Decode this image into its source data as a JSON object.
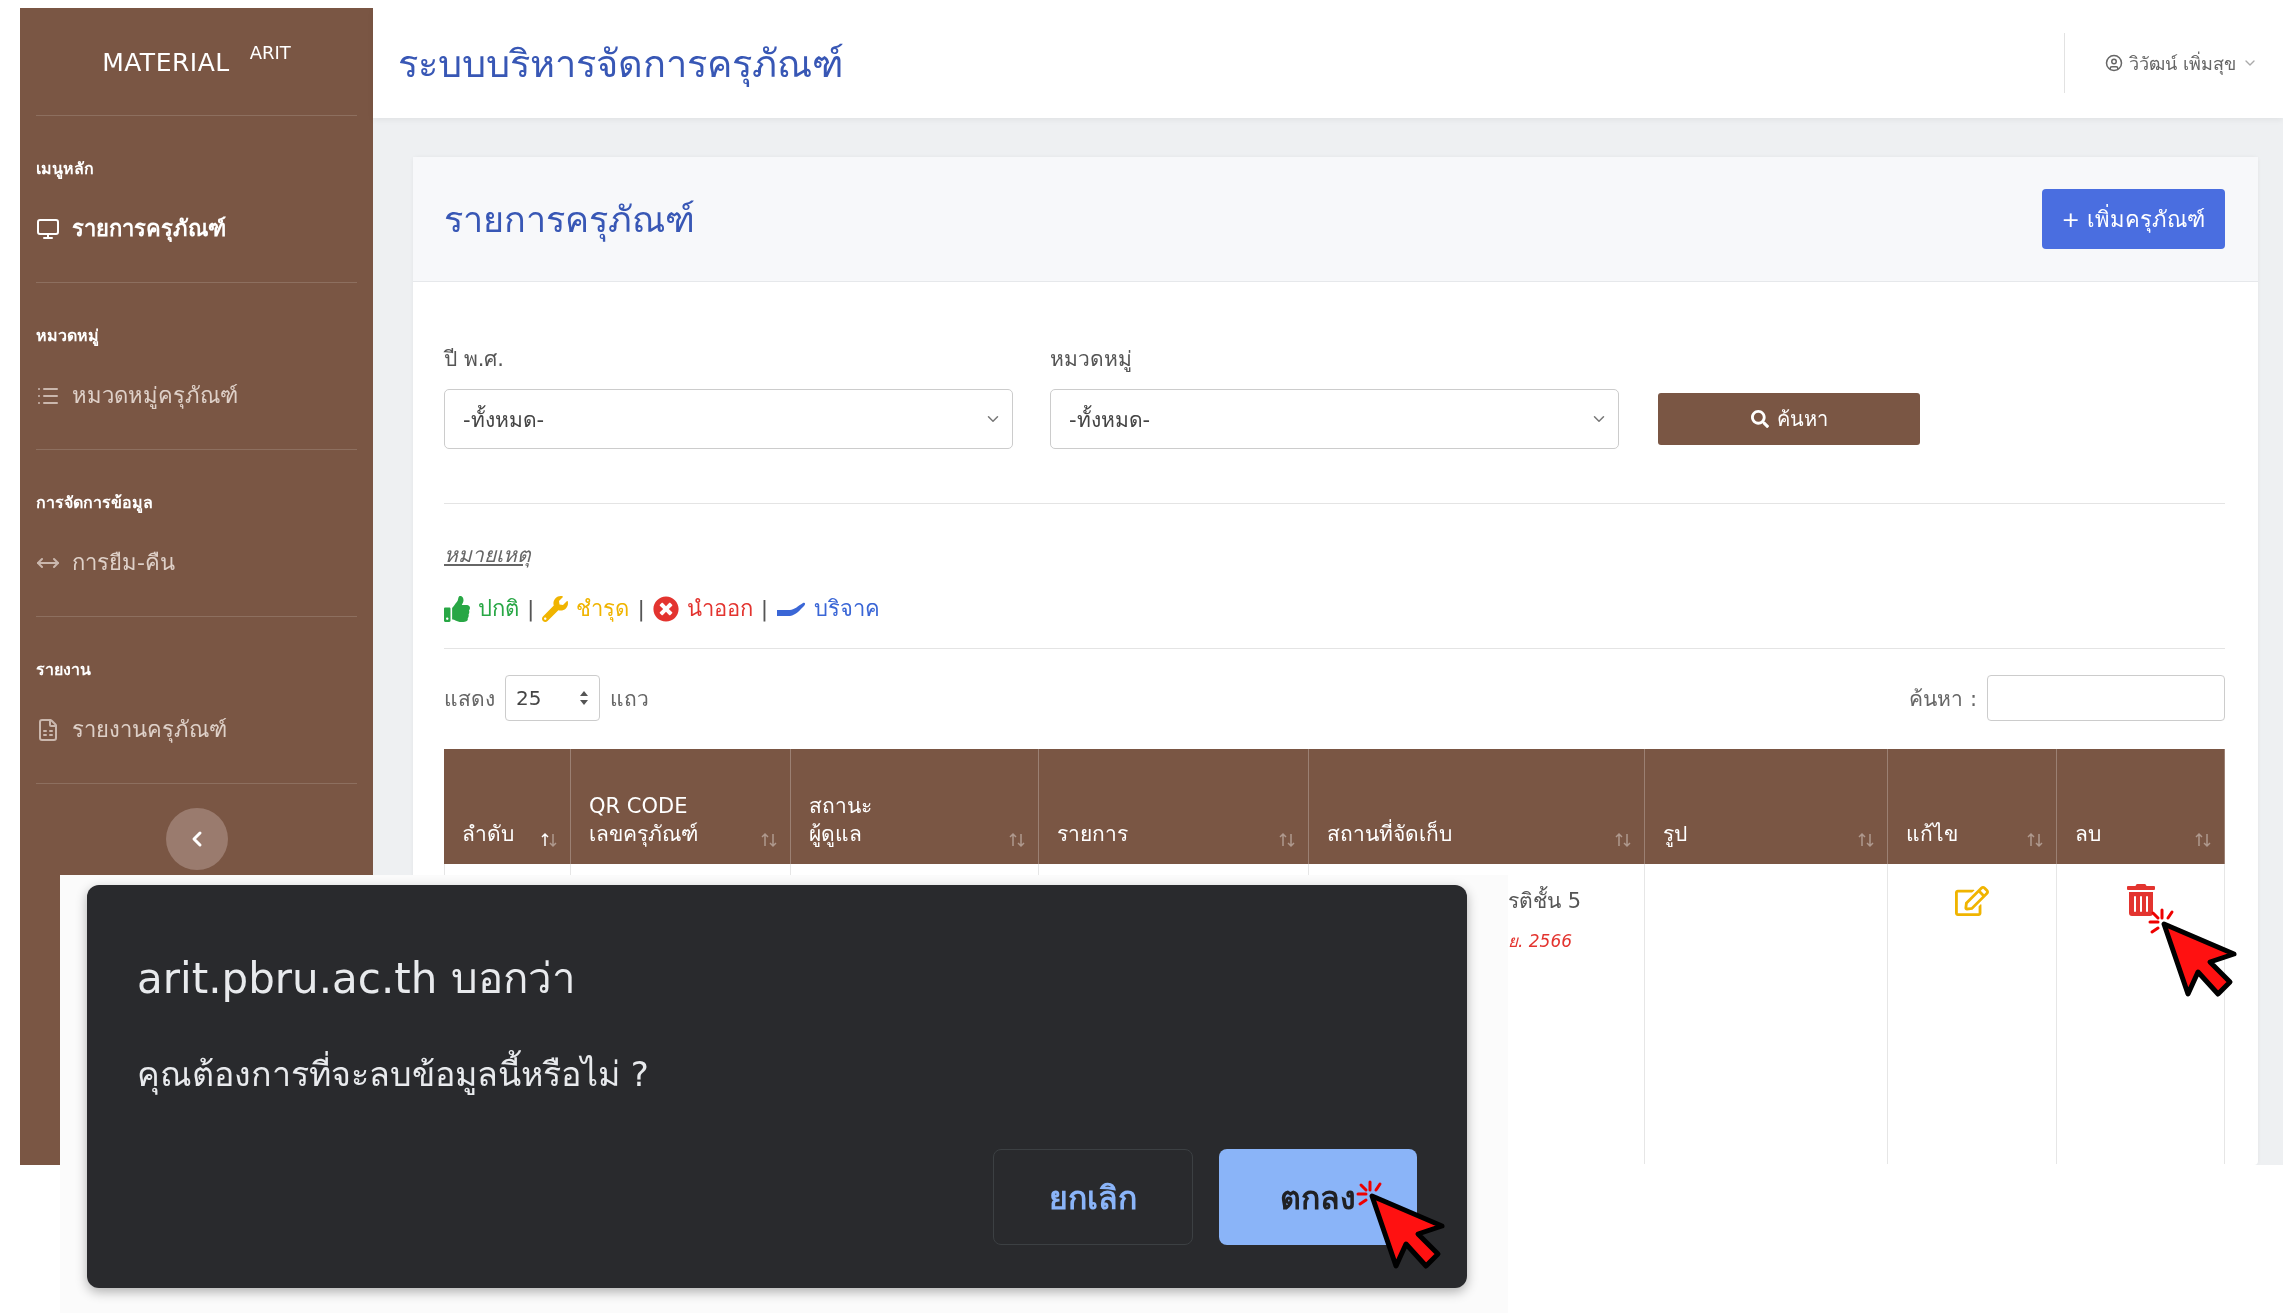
{
  "sidebar": {
    "brand": "MATERIAL",
    "brand_sup": "ARIT",
    "sections": [
      {
        "heading": "เมนูหลัก",
        "item": {
          "label": "รายการครุภัณฑ์",
          "kind": "monitor",
          "selected": true
        }
      },
      {
        "heading": "หมวดหมู่",
        "item": {
          "label": "หมวดหมู่ครุภัณฑ์",
          "kind": "list",
          "selected": false
        }
      },
      {
        "heading": "การจัดการข้อมูล",
        "item": {
          "label": "การยืม-คืน",
          "kind": "arrows",
          "selected": false
        }
      },
      {
        "heading": "รายงาน",
        "item": {
          "label": "รายงานครุภัณฑ์",
          "kind": "file",
          "selected": false
        }
      }
    ]
  },
  "header": {
    "title": "ระบบบริหารจัดการครุภัณฑ์",
    "user": "วิวัฒน์ เพิ่มสุข"
  },
  "card": {
    "title": "รายการครุภัณฑ์",
    "add_button": "+ เพิ่มครุภัณฑ์"
  },
  "filters": [
    {
      "label": "ปี พ.ศ.",
      "value": "-ทั้งหมด-"
    },
    {
      "label": "หมวดหมู่",
      "value": "-ทั้งหมด-"
    }
  ],
  "search_button": "ค้นหา",
  "legend": {
    "title": "หมายเหตุ",
    "separator": "|",
    "items": [
      {
        "label": "ปกติ",
        "kind": "thumbs",
        "color": "#28a745"
      },
      {
        "label": "ชำรุด",
        "kind": "wrench",
        "color": "#f0b400"
      },
      {
        "label": "นำออก",
        "kind": "cross",
        "color": "#e3342f"
      },
      {
        "label": "บริจาค",
        "kind": "hand",
        "color": "#3a66d6"
      }
    ]
  },
  "table_controls": {
    "show_label": "แสดง",
    "page_size": "25",
    "rows_label": "แถว",
    "search_label": "ค้นหา :"
  },
  "table": {
    "columns": [
      {
        "lines": [
          "ลำดับ"
        ],
        "sorted": true
      },
      {
        "lines": [
          "QR CODE",
          "เลขครุภัณฑ์"
        ],
        "sorted": false
      },
      {
        "lines": [
          "สถานะ",
          "ผู้ดูแล"
        ],
        "sorted": false
      },
      {
        "lines": [
          "รายการ"
        ],
        "sorted": false
      },
      {
        "lines": [
          "สถานที่จัดเก็บ"
        ],
        "sorted": false
      },
      {
        "lines": [
          "รูป"
        ],
        "sorted": false
      },
      {
        "lines": [
          "แก้ไข"
        ],
        "sorted": false
      },
      {
        "lines": [
          "ลบ"
        ],
        "sorted": false
      }
    ],
    "rows": [
      {
        "location": "รติชั้น 5",
        "location_note": "ย. 2566"
      }
    ]
  },
  "dialog": {
    "origin": "arit.pbru.ac.th บอกว่า",
    "message": "คุณต้องการที่จะลบข้อมูลนี้หรือไม่ ?",
    "buttons": [
      {
        "label": "ยกเลิก",
        "primary": false
      },
      {
        "label": "ตกลง",
        "primary": true
      }
    ]
  }
}
